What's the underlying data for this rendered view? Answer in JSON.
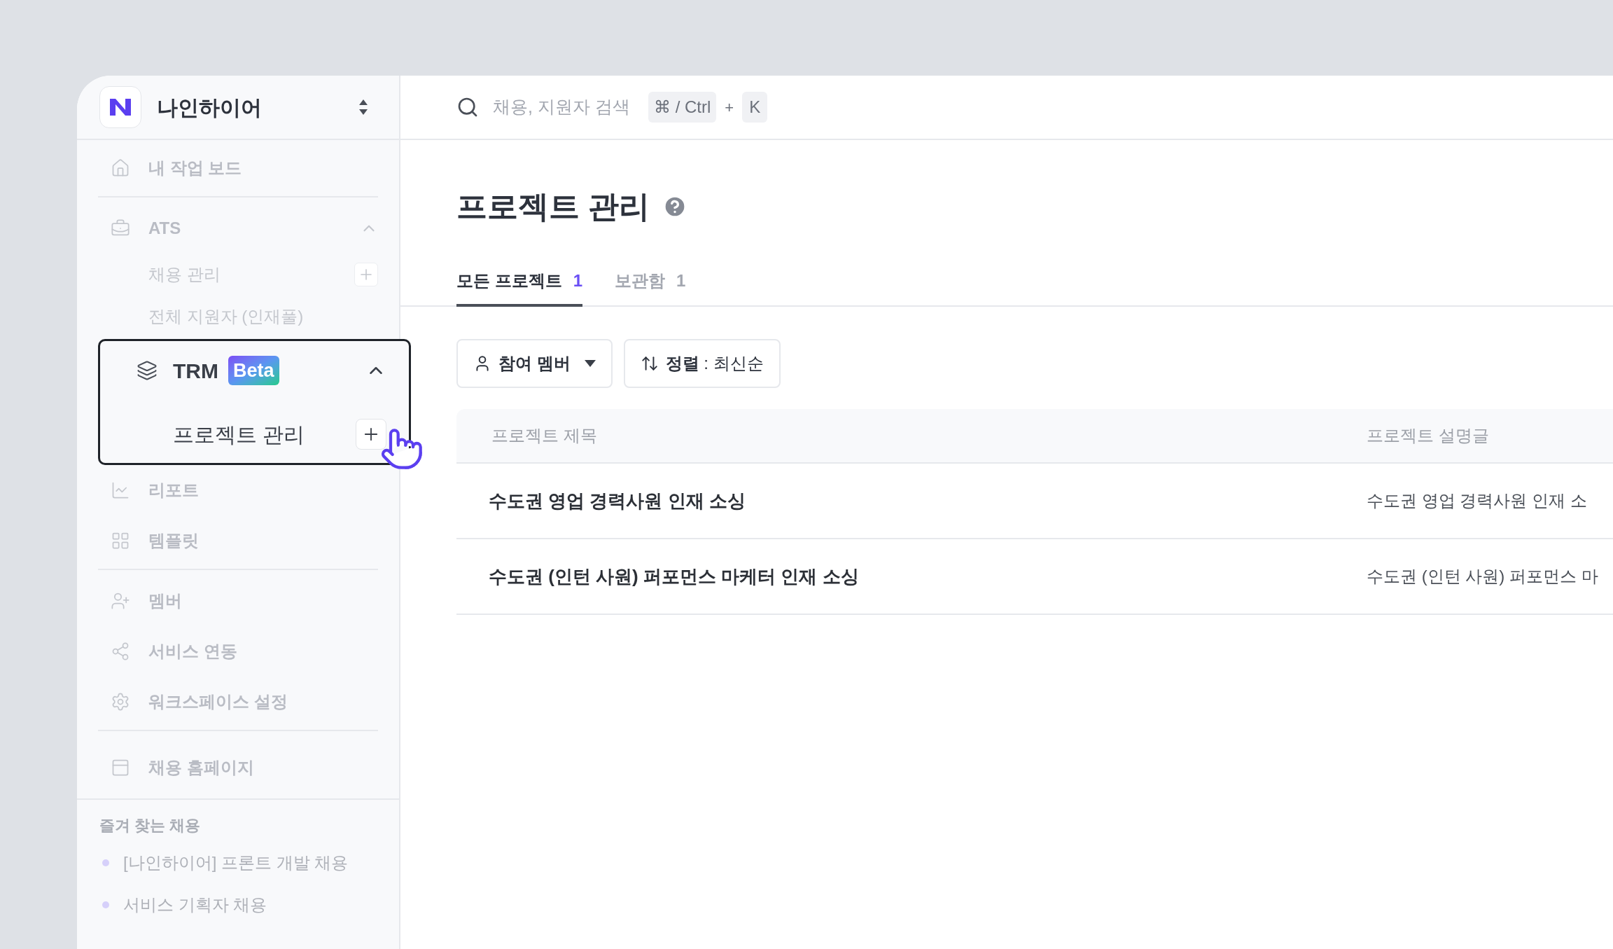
{
  "workspace": {
    "name": "나인하이어"
  },
  "sidebar": {
    "groups": [
      {
        "items": [
          {
            "label": "내 작업 보드"
          }
        ]
      },
      {
        "items": [
          {
            "label": "ATS",
            "expanded": true,
            "highlighted": false,
            "children": [
              {
                "label": "채용 관리",
                "add_button": true
              },
              {
                "label": "전체 지원자 (인재풀)",
                "add_button": false
              }
            ]
          },
          {
            "label": "TRM",
            "badge": "Beta",
            "expanded": true,
            "highlighted": true,
            "children": [
              {
                "label": "프로젝트 관리",
                "add_button": true
              }
            ]
          },
          {
            "label": "리포트"
          },
          {
            "label": "템플릿"
          }
        ]
      },
      {
        "items": [
          {
            "label": "멤버"
          },
          {
            "label": "서비스 연동"
          },
          {
            "label": "워크스페이스 설정"
          }
        ]
      },
      {
        "items": [
          {
            "label": "채용 홈페이지"
          }
        ]
      }
    ],
    "favorites": {
      "title": "즐겨 찾는 채용",
      "items": [
        {
          "label": "[나인하이어] 프론트 개발 채용"
        },
        {
          "label": "서비스 기획자 채용"
        }
      ]
    }
  },
  "search": {
    "placeholder": "채용, 지원자 검색",
    "keys": [
      "⌘ / Ctrl",
      "K"
    ],
    "joiner": "+"
  },
  "page": {
    "title": "프로젝트 관리"
  },
  "tabs": [
    {
      "label": "모든 프로젝트",
      "count": "1",
      "selected": true
    },
    {
      "label": "보관함",
      "count": "1",
      "selected": false
    }
  ],
  "filters": [
    {
      "kind": "member",
      "label": "참여 멤버"
    },
    {
      "kind": "sort",
      "label": "**정렬** : 최신순"
    }
  ],
  "table": {
    "columns": [
      "프로젝트 제목",
      "프로젝트 설명글"
    ],
    "rows": [
      {
        "cells": [
          "수도권 영업 경력사원 인재 소싱",
          "수도권 영업 경력사원 인재 소"
        ]
      },
      {
        "cells": [
          "수도권 (인턴 사원) 퍼포먼스 마케터 인재 소싱",
          "수도권 (인턴 사원) 퍼포먼스 마"
        ]
      }
    ]
  }
}
